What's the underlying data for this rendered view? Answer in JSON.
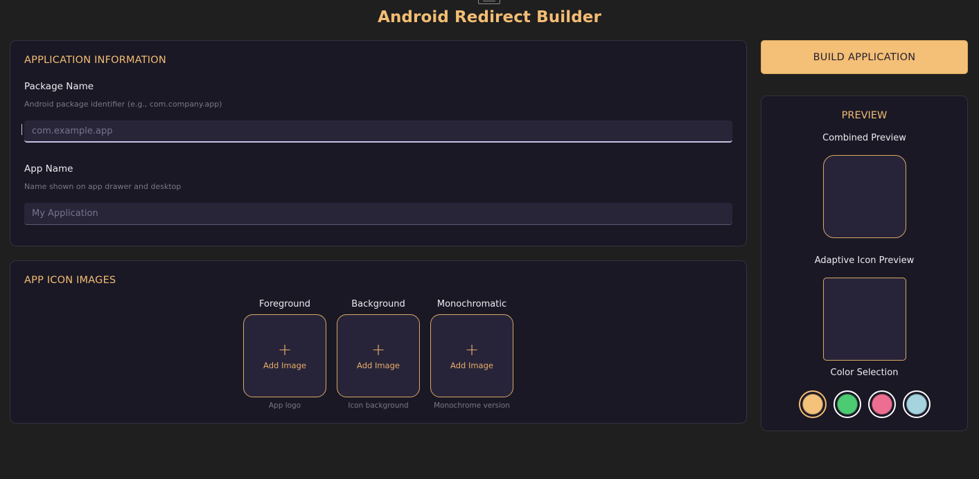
{
  "header": {
    "title": "Android Redirect Builder"
  },
  "app_info": {
    "heading": "APPLICATION INFORMATION",
    "package_name": {
      "label": "Package Name",
      "hint": "Android package identifier (e.g., com.company.app)",
      "placeholder": "com.example.app",
      "value": ""
    },
    "app_name": {
      "label": "App Name",
      "hint": "Name shown on app drawer and desktop",
      "placeholder": "My Application",
      "value": ""
    }
  },
  "icon_images": {
    "heading": "APP ICON IMAGES",
    "slots": [
      {
        "title": "Foreground",
        "action": "Add Image",
        "caption": "App logo"
      },
      {
        "title": "Background",
        "action": "Add Image",
        "caption": "Icon background"
      },
      {
        "title": "Monochromatic",
        "action": "Add Image",
        "caption": "Monochrome version"
      }
    ]
  },
  "build_button": {
    "label": "BUILD APPLICATION"
  },
  "preview": {
    "heading": "PREVIEW",
    "combined_label": "Combined Preview",
    "adaptive_label": "Adaptive Icon Preview",
    "color_label": "Color Selection",
    "colors": [
      "#f4c27b",
      "#4ccb72",
      "#ec6f91",
      "#a5d3de"
    ],
    "selected_color_index": 0
  },
  "colors": {
    "accent": "#f3bd74",
    "background": "#1f1f1f",
    "card": "#1a1825",
    "input": "#282539"
  },
  "icons": {
    "top": "window-icon",
    "upload": "plus-icon"
  }
}
